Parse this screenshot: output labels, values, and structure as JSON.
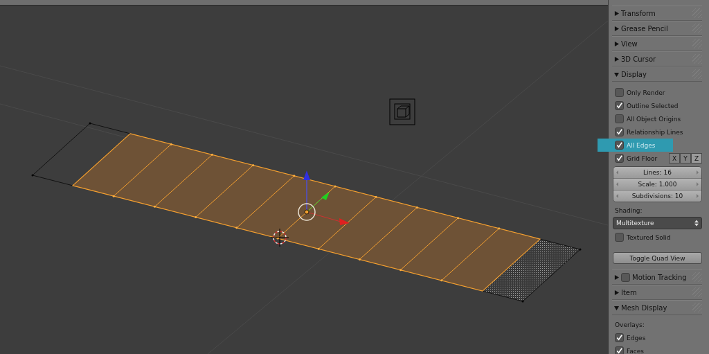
{
  "sidebar": {
    "panels": [
      {
        "title": "Transform",
        "expanded": false
      },
      {
        "title": "Grease Pencil",
        "expanded": false
      },
      {
        "title": "View",
        "expanded": false
      },
      {
        "title": "3D Cursor",
        "expanded": false
      },
      {
        "title": "Display",
        "expanded": true,
        "items": [
          {
            "kind": "checkbox",
            "label": "Only Render",
            "checked": false,
            "highlighted": false
          },
          {
            "kind": "checkbox",
            "label": "Outline Selected",
            "checked": true,
            "highlighted": false
          },
          {
            "kind": "checkbox",
            "label": "All Object Origins",
            "checked": false,
            "highlighted": false
          },
          {
            "kind": "checkbox",
            "label": "Relationship Lines",
            "checked": true,
            "highlighted": false
          },
          {
            "kind": "checkbox",
            "label": "All Edges",
            "checked": true,
            "highlighted": true
          },
          {
            "kind": "checkbox_axes",
            "label": "Grid Floor",
            "checked": true,
            "highlighted": false,
            "axes": [
              {
                "label": "X",
                "selected": false
              },
              {
                "label": "Y",
                "selected": false
              },
              {
                "label": "Z",
                "selected": true
              }
            ]
          },
          {
            "kind": "number_fields",
            "fields": [
              "Lines: 16",
              "Scale: 1.000",
              "Subdivisions: 10"
            ]
          },
          {
            "kind": "label",
            "label": "Shading:"
          },
          {
            "kind": "dropdown",
            "value": "Multitexture"
          },
          {
            "kind": "checkbox",
            "label": "Textured Solid",
            "checked": false,
            "highlighted": false
          },
          {
            "kind": "button",
            "label": "Toggle Quad View"
          }
        ]
      },
      {
        "title": "Motion Tracking",
        "expanded": false,
        "checkbox": false
      },
      {
        "title": "Item",
        "expanded": false
      },
      {
        "title": "Mesh Display",
        "expanded": true,
        "items": [
          {
            "kind": "label",
            "label": "Overlays:"
          },
          {
            "kind": "checkbox",
            "label": "Edges",
            "checked": true,
            "highlighted": false
          },
          {
            "kind": "checkbox",
            "label": "Faces",
            "checked": true,
            "highlighted": false
          }
        ]
      }
    ]
  }
}
